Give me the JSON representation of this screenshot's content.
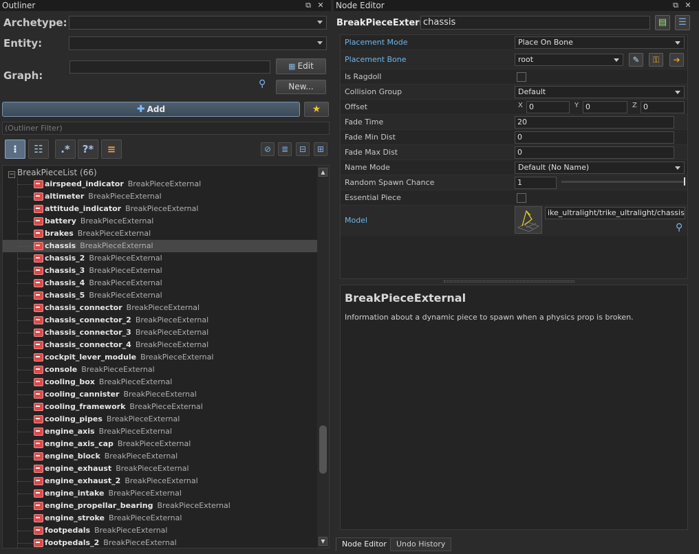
{
  "outliner": {
    "title": "Outliner",
    "archetype_label": "Archetype:",
    "entity_label": "Entity:",
    "graph_label": "Graph:",
    "edit_label": "Edit",
    "new_label": "New...",
    "add_label": "Add",
    "filter_placeholder": "(Outliner Filter)",
    "toolbar_regex": ".*",
    "toolbar_query": "?*",
    "tree": {
      "root_label": "BreakPieceList (66)",
      "type_label": "BreakPieceExternal",
      "items": [
        {
          "name": "airspeed_indicator",
          "type": "BreakPieceExternal"
        },
        {
          "name": "altimeter",
          "type": "BreakPieceExternal"
        },
        {
          "name": "attitude_indicator",
          "type": "BreakPieceExternal"
        },
        {
          "name": "battery",
          "type": "BreakPieceExternal"
        },
        {
          "name": "brakes",
          "type": "BreakPieceExternal"
        },
        {
          "name": "chassis",
          "type": "BreakPieceExternal"
        },
        {
          "name": "chassis_2",
          "type": "BreakPieceExternal"
        },
        {
          "name": "chassis_3",
          "type": "BreakPieceExternal"
        },
        {
          "name": "chassis_4",
          "type": "BreakPieceExternal"
        },
        {
          "name": "chassis_5",
          "type": "BreakPieceExternal"
        },
        {
          "name": "chassis_connector",
          "type": "BreakPieceExternal"
        },
        {
          "name": "chassis_connector_2",
          "type": "BreakPieceExternal"
        },
        {
          "name": "chassis_connector_3",
          "type": "BreakPieceExternal"
        },
        {
          "name": "chassis_connector_4",
          "type": "BreakPieceExternal"
        },
        {
          "name": "cockpit_lever_module",
          "type": "BreakPieceExternal"
        },
        {
          "name": "console",
          "type": "BreakPieceExternal"
        },
        {
          "name": "cooling_box",
          "type": "BreakPieceExternal"
        },
        {
          "name": "cooling_cannister",
          "type": "BreakPieceExternal"
        },
        {
          "name": "cooling_framework",
          "type": "BreakPieceExternal"
        },
        {
          "name": "cooling_pipes",
          "type": "BreakPieceExternal"
        },
        {
          "name": "engine_axis",
          "type": "BreakPieceExternal"
        },
        {
          "name": "engine_axis_cap",
          "type": "BreakPieceExternal"
        },
        {
          "name": "engine_block",
          "type": "BreakPieceExternal"
        },
        {
          "name": "engine_exhaust",
          "type": "BreakPieceExternal"
        },
        {
          "name": "engine_exhaust_2",
          "type": "BreakPieceExternal"
        },
        {
          "name": "engine_intake",
          "type": "BreakPieceExternal"
        },
        {
          "name": "engine_propellar_bearing",
          "type": "BreakPieceExternal"
        },
        {
          "name": "engine_stroke",
          "type": "BreakPieceExternal"
        },
        {
          "name": "footpedals",
          "type": "BreakPieceExternal"
        },
        {
          "name": "footpedals_2",
          "type": "BreakPieceExternal"
        }
      ]
    }
  },
  "node_editor": {
    "title": "Node Editor",
    "node_type": "BreakPieceExternal",
    "node_name": "chassis",
    "properties": {
      "placement_mode": {
        "label": "Placement Mode",
        "value": "Place On Bone"
      },
      "placement_bone": {
        "label": "Placement Bone",
        "value": "root"
      },
      "is_ragdoll": {
        "label": "Is Ragdoll"
      },
      "collision_group": {
        "label": "Collision Group",
        "value": "Default"
      },
      "offset": {
        "label": "Offset",
        "x_label": "X",
        "y_label": "Y",
        "z_label": "Z",
        "x": "0",
        "y": "0",
        "z": "0"
      },
      "fade_time": {
        "label": "Fade Time",
        "value": "20"
      },
      "fade_min_dist": {
        "label": "Fade Min Dist",
        "value": "0"
      },
      "fade_max_dist": {
        "label": "Fade Max Dist",
        "value": "0"
      },
      "name_mode": {
        "label": "Name Mode",
        "value": "Default (No Name)"
      },
      "random_spawn_chance": {
        "label": "Random Spawn Chance",
        "value": "1",
        "slider_level": 1.0
      },
      "essential_piece": {
        "label": "Essential Piece"
      },
      "model": {
        "label": "Model",
        "value": "ike_ultralight/trike_ultralight/chassis.vmdl"
      }
    },
    "help": {
      "title": "BreakPieceExternal",
      "text": "Information about a dynamic piece to spawn when a physics prop is broken."
    },
    "tabs": [
      {
        "label": "Node Editor",
        "active": true
      },
      {
        "label": "Undo History",
        "active": false
      }
    ]
  },
  "colors": {
    "link_label": "#6fb7ec",
    "selected_row": "#474747",
    "item_icon": "#d94b4b",
    "add_button_border": "#7a94ab"
  },
  "icons": [
    "pin-icon",
    "close-icon",
    "search-icon",
    "plus-icon",
    "star-icon",
    "tree-view-icon",
    "hierarchy-icon",
    "regex-icon",
    "query-icon",
    "list-icon",
    "dropper-icon",
    "key-icon",
    "arrow-right-icon",
    "new-node-icon",
    "list-view-icon",
    "model-thumbnail"
  ]
}
